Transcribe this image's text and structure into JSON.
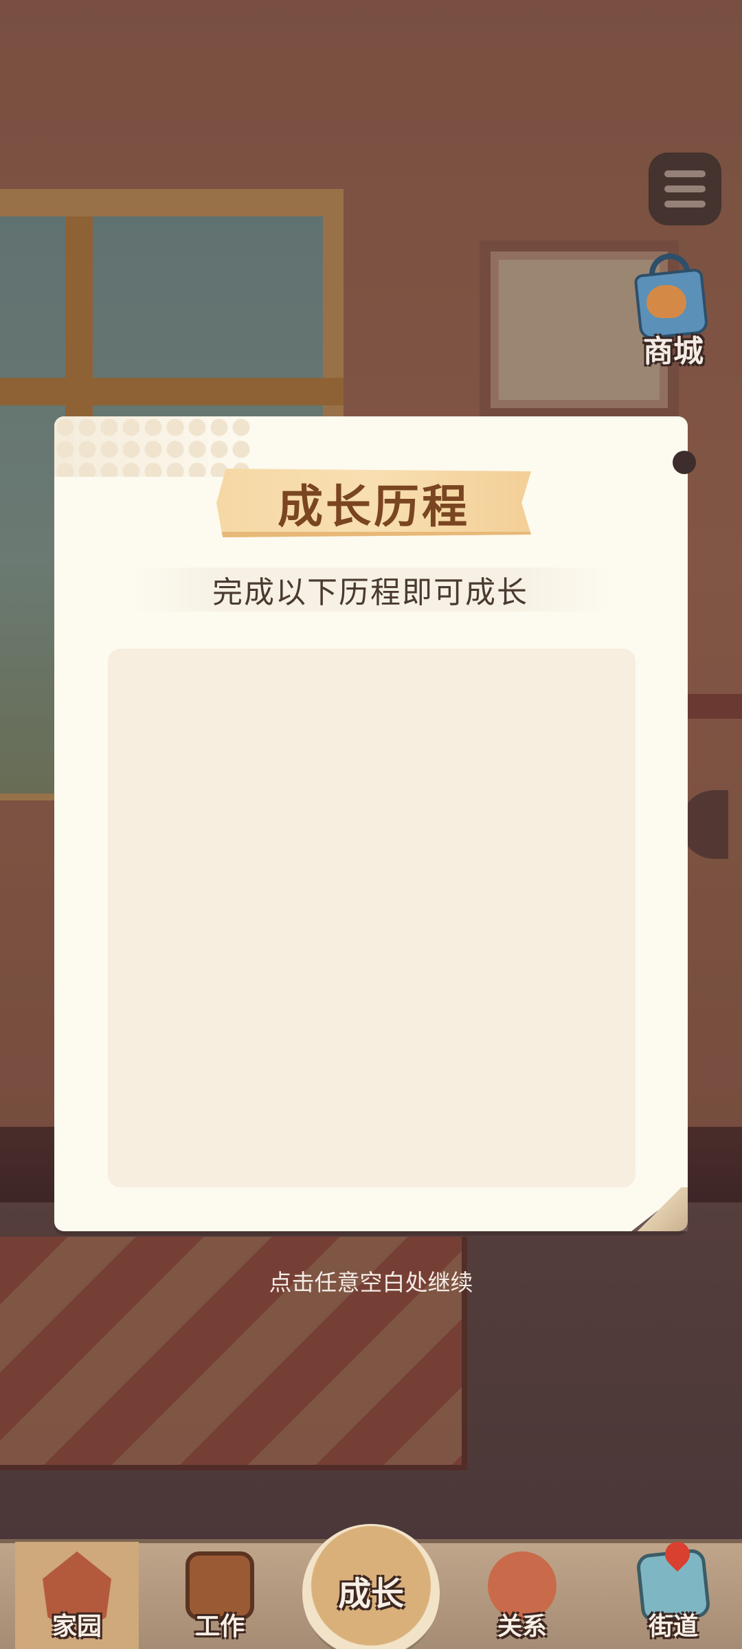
{
  "hud": {
    "menu_icon": "hamburger-menu-icon",
    "shop_label": "商城",
    "shop_icon": "shiba-shopping-bag-icon"
  },
  "dialog": {
    "title": "成长历程",
    "subtitle": "完成以下历程即可成长"
  },
  "continue_hint": "点击任意空白处继续",
  "nav": {
    "items": [
      {
        "label": "家园",
        "icon": "house-icon"
      },
      {
        "label": "工作",
        "icon": "briefcase-icon"
      },
      {
        "label": "成长",
        "icon": "growth-clock-icon",
        "active": true
      },
      {
        "label": "关系",
        "icon": "people-icon"
      },
      {
        "label": "街道",
        "icon": "map-pin-icon"
      }
    ]
  },
  "colors": {
    "dialog_bg": "#fdfaf0",
    "ribbon": "#f6d8a5",
    "title_text": "#7a4521",
    "content_bg": "#f7eedf"
  }
}
